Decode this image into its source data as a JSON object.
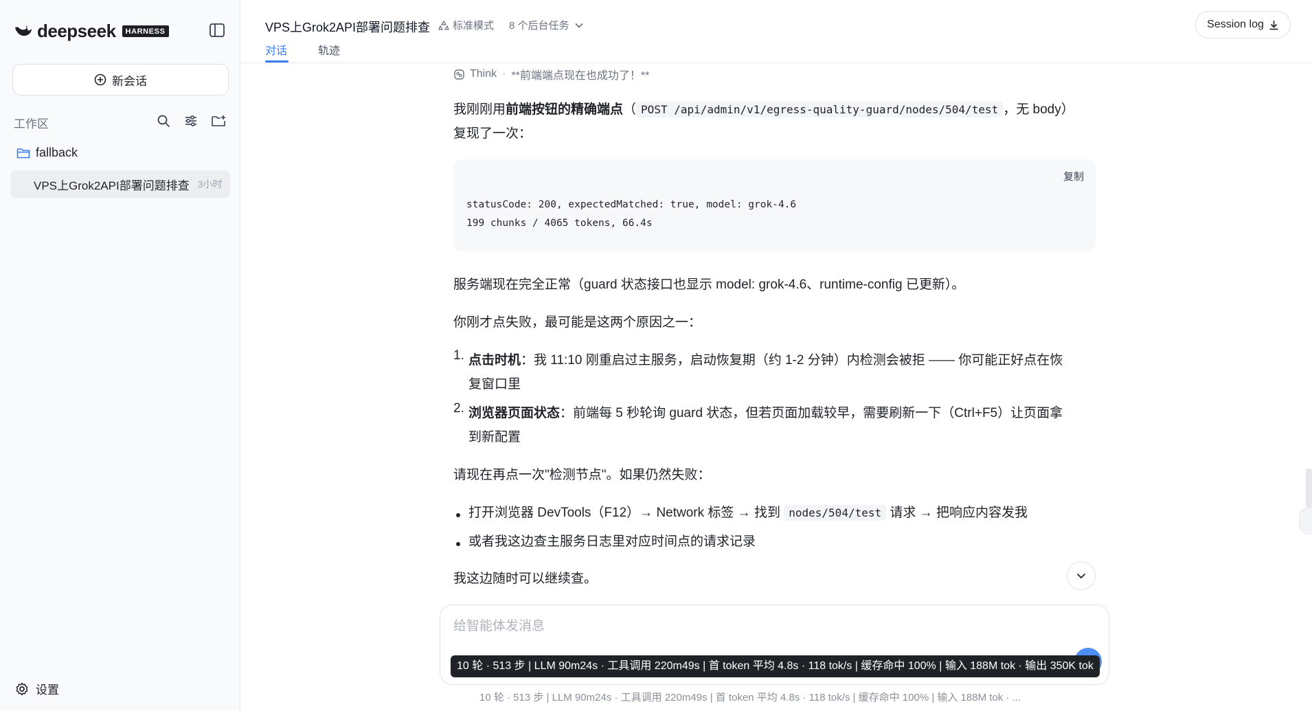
{
  "sidebar": {
    "brand": {
      "name": "deepseek",
      "badge": "HARNESS"
    },
    "new_chat_label": "新会话",
    "workspace_label": "工作区",
    "folder_name": "fallback",
    "sessions": [
      {
        "title": "VPS上Grok2API部署问题排查",
        "time": "3小时"
      }
    ],
    "settings_label": "设置"
  },
  "header": {
    "title": "VPS上Grok2API部署问题排查",
    "mode": "标准模式",
    "tasks": "8 个后台任务",
    "tabs": [
      {
        "label": "对话",
        "active": true
      },
      {
        "label": "轨迹",
        "active": false
      }
    ],
    "session_log_label": "Session log"
  },
  "message": {
    "think_label": "Think",
    "think_text": "**前端端点现在也成功了！**",
    "p1": {
      "a": "我刚刚用",
      "b": "前端按钮的精确端点",
      "c": "（",
      "code": "POST /api/admin/v1/egress-quality-guard/nodes/504/test",
      "d": "，无 body）",
      "line2": "复现了一次："
    },
    "codeblock": {
      "copy_label": "复制",
      "lines": "statusCode: 200, expectedMatched: true, model: grok-4.6\n199 chunks / 4065 tokens, 66.4s"
    },
    "p2": "服务端现在完全正常（guard 状态接口也显示 model: grok-4.6、runtime-config 已更新）。",
    "p3": "你刚才点失败，最可能是这两个原因之一：",
    "ol": [
      {
        "num": "1.",
        "bold": "点击时机",
        "text": "：我 11:10 刚重启过主服务，启动恢复期（约 1-2 分钟）内检测会被拒 —— 你可能正好点在恢",
        "cont": "复窗口里"
      },
      {
        "num": "2.",
        "bold": "浏览器页面状态",
        "text": "：前端每 5 秒轮询 guard 状态，但若页面加载较早，需要刷新一下（Ctrl+F5）让页面拿",
        "cont": "到新配置"
      }
    ],
    "p4": "请现在再点一次\"检测节点\"。如果仍然失败：",
    "ul": [
      {
        "a": "打开浏览器 DevTools（F12）→ Network 标签 → 找到 ",
        "code": "nodes/504/test",
        "b": " 请求 → 把响应内容发我"
      },
      {
        "a": "或者我这边查主服务日志里对应时间点的请求记录"
      }
    ],
    "p5": "我这边随时可以继续查。"
  },
  "composer": {
    "placeholder": "给智能体发消息",
    "tooltip": "10 轮 · 513 步 | LLM 90m24s · 工具调用 220m49s | 首 token 平均 4.8s · 118 tok/s | 缓存命中 100% | 输入 188M tok · 输出 350K tok"
  },
  "footer_stats": "10 轮 · 513 步  |   LLM 90m24s · 工具调用 220m49s   |   首 token 平均 4.8s · 118 tok/s   |   缓存命中 100%   |   输入 188M tok · ...",
  "colors": {
    "accent": "#3b7cf0",
    "send": "#4d8ef7",
    "tooltip_bg": "#1f2328"
  }
}
